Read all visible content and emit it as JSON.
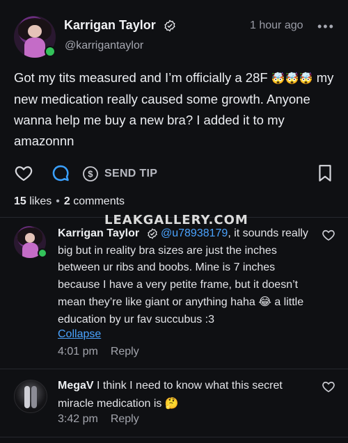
{
  "post": {
    "author_name": "Karrigan Taylor",
    "handle": "@karrigantaylor",
    "time": "1 hour ago",
    "more": "•••",
    "text_line1": "Got my tits measured and I’m officially a 28F",
    "text_emoji": "🤯🤯🤯",
    "text_rest": "my new medication really caused some growth. Anyone wanna help me buy a new bra? I added it to my amazonnn",
    "send_tip_label": "SEND TIP",
    "likes_count": "15",
    "likes_label": "likes",
    "separator": "•",
    "comments_count": "2",
    "comments_label": "comments"
  },
  "watermark": "LEAKGALLERY.COM",
  "comments": [
    {
      "author": "Karrigan Taylor",
      "mention": "@u78938179",
      "text": ", it sounds really big but in reality bra sizes are just the inches between ur ribs and boobs. Mine is 7 inches because I have a very petite frame, but it doesn’t mean they’re like giant or anything haha",
      "emoji": "😂",
      "text_end": " a little education by ur fav succubus :3",
      "collapse": "Collapse",
      "time": "4:01 pm",
      "reply": "Reply"
    },
    {
      "author": "MegaV",
      "text": " I think I need to know what this secret miracle medication is",
      "emoji": "🤔",
      "time": "3:42 pm",
      "reply": "Reply"
    }
  ],
  "colors": {
    "background": "#0f1013",
    "link": "#4aa3ff",
    "online": "#33c25a",
    "comment_icon_accent": "#3aa0ff"
  },
  "icons": [
    "verified-icon",
    "heart-icon",
    "comment-icon",
    "dollar-icon",
    "bookmark-icon",
    "more-icon"
  ]
}
